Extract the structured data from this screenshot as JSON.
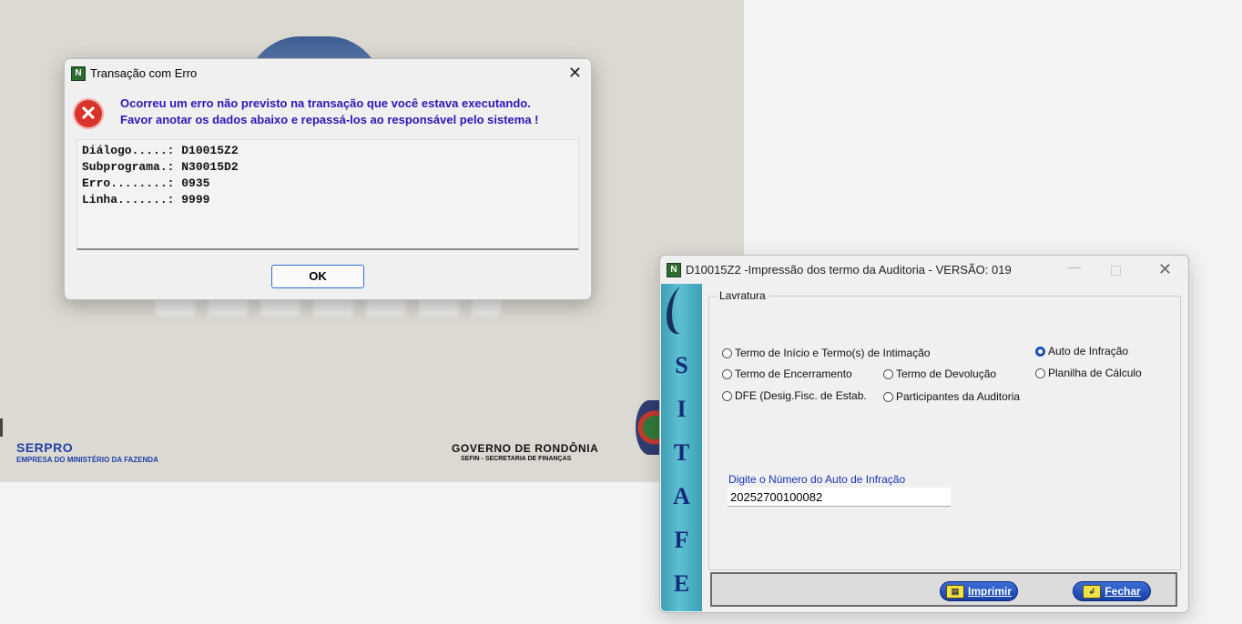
{
  "background": {
    "serpro_name": "SERPRO",
    "serpro_subtitle": "EMPRESA DO MINISTÉRIO DA FAZENDA",
    "gov_name": "GOVERNO DE RONDÔNIA",
    "gov_subtitle": "SEFIN - SECRETARIA DE FINANÇAS"
  },
  "error_dialog": {
    "app_icon": "N",
    "title": "Transação com Erro",
    "close_glyph": "✕",
    "error_icon_glyph": "✕",
    "message_line1": "Ocorreu um erro não previsto na transação que você estava executando.",
    "message_line2": "Favor anotar os dados abaixo e repassá-los ao responsável pelo sistema !",
    "details": [
      "Diálogo.....: D10015Z2",
      "Subprograma.: N30015D2",
      "Erro........: 0935",
      "Linha.......: 9999"
    ],
    "ok_label": "OK"
  },
  "sitafe_window": {
    "app_icon": "N",
    "title": "D10015Z2 -Impressão dos termo da Auditoria - VERSÃO: 019",
    "minimize_glyph": "—",
    "close_glyph": "✕",
    "banner_letters": [
      "S",
      "I",
      "T",
      "A",
      "F",
      "E"
    ],
    "group_title": "Lavratura",
    "options": [
      {
        "label": "Termo de Início e Termo(s) de Intimação",
        "selected": false
      },
      {
        "label": "Auto de Infração",
        "selected": true
      },
      {
        "label": "Termo de Encerramento",
        "selected": false
      },
      {
        "label": "Termo de Devolução",
        "selected": false
      },
      {
        "label": "Planilha de Cálculo",
        "selected": false
      },
      {
        "label": "DFE (Desig.Fisc. de Estab.",
        "selected": false
      },
      {
        "label": "Participantes da Auditoria",
        "selected": false
      }
    ],
    "auto_label": "Digite o Número do Auto de Infração",
    "auto_value": "20252700100082",
    "print_label": "Imprimir",
    "close_label": "Fechar",
    "accent_color": "#1a4fb8"
  }
}
